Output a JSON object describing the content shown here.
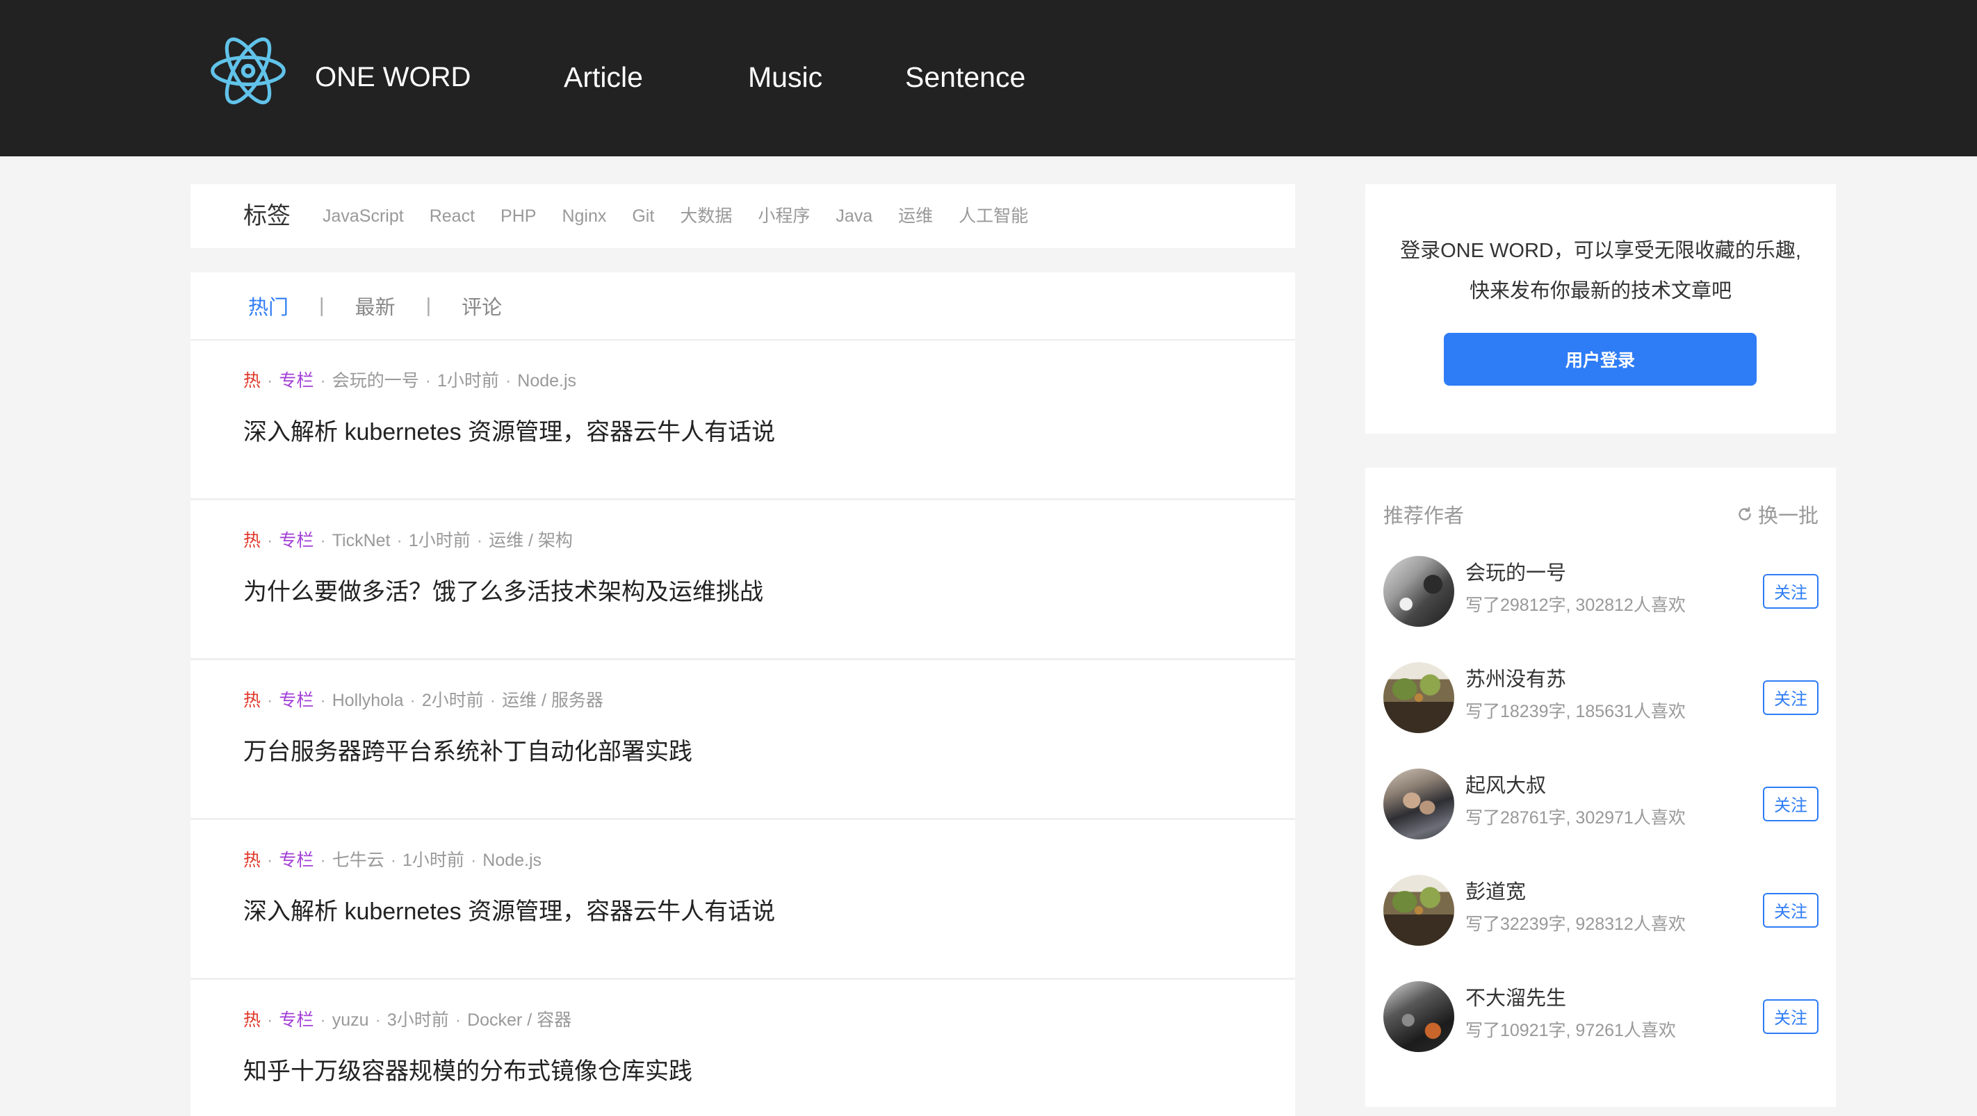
{
  "colors": {
    "header_bg": "#222222",
    "page_bg": "#f4f4f4",
    "accent": "#2e7cf6",
    "hot": "#e0392b",
    "column": "#a23ed6",
    "logo": "#61c3ea"
  },
  "header": {
    "logo_icon": "react-atom-icon",
    "brand": "ONE WORD",
    "nav": [
      {
        "label": "Article"
      },
      {
        "label": "Music"
      },
      {
        "label": "Sentence"
      }
    ]
  },
  "tags": {
    "title": "标签",
    "items": [
      "JavaScript",
      "React",
      "PHP",
      "Nginx",
      "Git",
      "大数据",
      "小程序",
      "Java",
      "运维",
      "人工智能"
    ]
  },
  "feed": {
    "tabs": [
      {
        "label": "热门",
        "active": true
      },
      {
        "label": "最新",
        "active": false
      },
      {
        "label": "评论",
        "active": false
      }
    ],
    "tab_separator": "|",
    "meta_separator": "·",
    "articles": [
      {
        "hot": "热",
        "column": "专栏",
        "author": "会玩的一号",
        "time": "1小时前",
        "category": "Node.js",
        "title": "深入解析 kubernetes 资源管理，容器云牛人有话说"
      },
      {
        "hot": "热",
        "column": "专栏",
        "author": "TickNet",
        "time": "1小时前",
        "category": "运维 / 架构",
        "title": "为什么要做多活？饿了么多活技术架构及运维挑战"
      },
      {
        "hot": "热",
        "column": "专栏",
        "author": "Hollyhola",
        "time": "2小时前",
        "category": "运维 / 服务器",
        "title": "万台服务器跨平台系统补丁自动化部署实践"
      },
      {
        "hot": "热",
        "column": "专栏",
        "author": "七牛云",
        "time": "1小时前",
        "category": "Node.js",
        "title": "深入解析 kubernetes 资源管理，容器云牛人有话说"
      },
      {
        "hot": "热",
        "column": "专栏",
        "author": "yuzu",
        "time": "3小时前",
        "category": "Docker / 容器",
        "title": "知乎十万级容器规模的分布式镜像仓库实践"
      }
    ]
  },
  "login": {
    "line1": "登录ONE WORD，可以享受无限收藏的乐趣,",
    "line2": "快来发布你最新的技术文章吧",
    "button": "用户登录"
  },
  "authors": {
    "title": "推荐作者",
    "refresh_icon": "refresh-icon",
    "refresh": "换一批",
    "items": [
      {
        "name": "会玩的一号",
        "stats": "写了29812字, 302812人喜欢",
        "follow": "关注"
      },
      {
        "name": "苏州没有苏",
        "stats": "写了18239字, 185631人喜欢",
        "follow": "关注"
      },
      {
        "name": "起风大叔",
        "stats": "写了28761字, 302971人喜欢",
        "follow": "关注"
      },
      {
        "name": "彭道宽",
        "stats": "写了32239字, 928312人喜欢",
        "follow": "关注"
      },
      {
        "name": "不大溜先生",
        "stats": "写了10921字, 97261人喜欢",
        "follow": "关注"
      }
    ]
  }
}
